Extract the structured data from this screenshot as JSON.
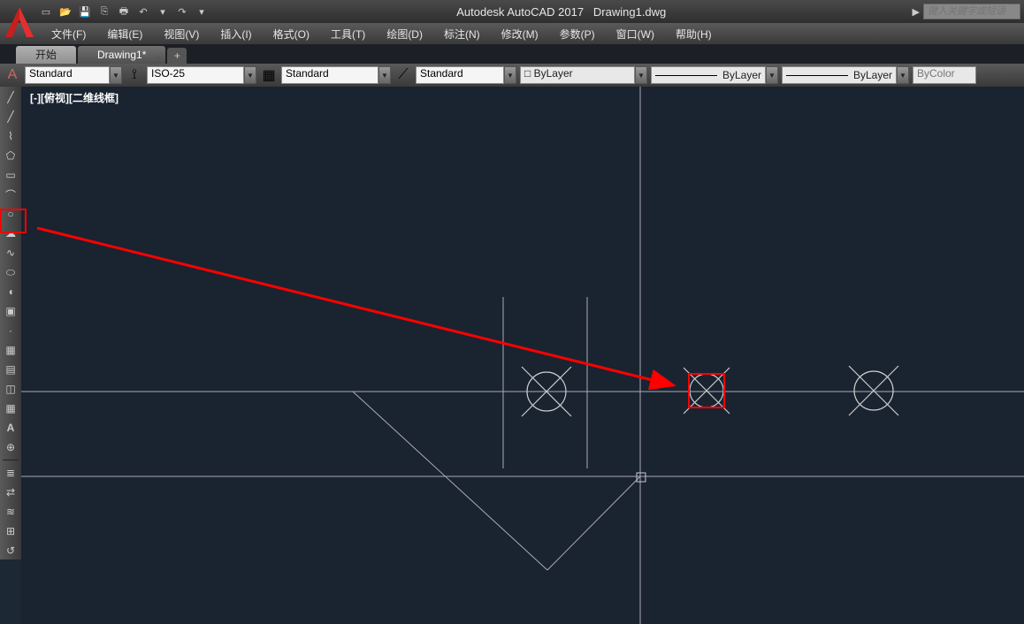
{
  "title": {
    "app": "Autodesk AutoCAD 2017",
    "doc": "Drawing1.dwg"
  },
  "search_placeholder": "键入关键字或短语",
  "menu": [
    "文件(F)",
    "编辑(E)",
    "视图(V)",
    "插入(I)",
    "格式(O)",
    "工具(T)",
    "绘图(D)",
    "标注(N)",
    "修改(M)",
    "参数(P)",
    "窗口(W)",
    "帮助(H)"
  ],
  "tabs": {
    "start": "开始",
    "active": "Drawing1*"
  },
  "props": {
    "text_style": "Standard",
    "dim_style": "ISO-25",
    "table_style": "Standard",
    "ml_style": "Standard",
    "layer": "ByLayer",
    "linetype": "ByLayer",
    "lineweight": "ByLayer",
    "color": "ByColor"
  },
  "viewport_label": "[-][俯视][二维线框]"
}
